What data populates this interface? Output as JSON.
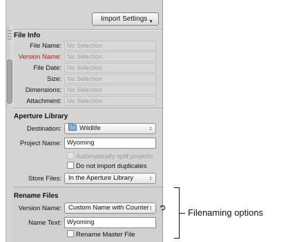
{
  "toolbar": {
    "import_settings_label": "Import Settings"
  },
  "file_info": {
    "title": "File Info",
    "rows": [
      {
        "label": "File Name:",
        "value": "No Selection"
      },
      {
        "label": "Version Name:",
        "value": "No Selection"
      },
      {
        "label": "File Date:",
        "value": "No Selection"
      },
      {
        "label": "Size:",
        "value": "No Selection"
      },
      {
        "label": "Dimensions:",
        "value": "No Selection"
      },
      {
        "label": "Attachment:",
        "value": "No Selection"
      }
    ]
  },
  "aperture_library": {
    "title": "Aperture Library",
    "destination_label": "Destination:",
    "destination_value": "Wildlife",
    "project_name_label": "Project Name:",
    "project_name_value": "Wyoming",
    "auto_split_label": "Automatically split projects",
    "no_duplicates_label": "Do not import duplicates",
    "store_files_label": "Store Files:",
    "store_files_value": "In the Aperture Library"
  },
  "rename_files": {
    "title": "Rename Files",
    "version_name_label": "Version Name:",
    "version_name_value": "Custom Name with Counter",
    "name_text_label": "Name Text:",
    "name_text_value": "Wyoming",
    "rename_master_label": "Rename Master File"
  },
  "callout": {
    "label": "Filenaming options"
  },
  "colors": {
    "highlight_label": "#a3221a",
    "panel_bg": "#d4d4d4"
  }
}
